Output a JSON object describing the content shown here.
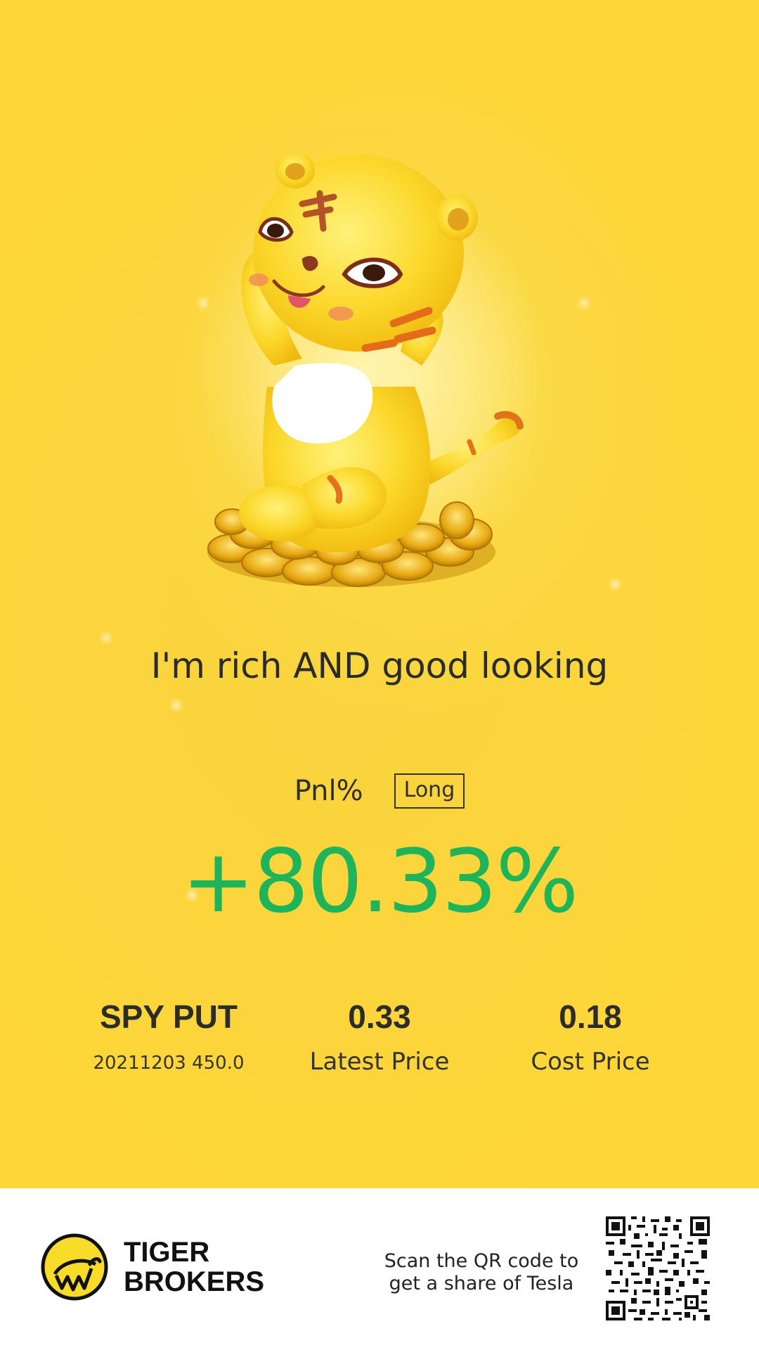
{
  "slogan": "I'm rich AND good looking",
  "pnl": {
    "label": "Pnl%",
    "position_type": "Long",
    "value": "+80.33%",
    "value_color": "#1db45b"
  },
  "stats": [
    {
      "main": "SPY PUT",
      "sub": "20211203 450.0"
    },
    {
      "main": "0.33",
      "sub": "Latest Price"
    },
    {
      "main": "0.18",
      "sub": "Cost Price"
    }
  ],
  "footer": {
    "brand_line1": "TIGER",
    "brand_line2": "BROKERS",
    "scan_line1": "Scan the QR code to",
    "scan_line2": "get a share of Tesla",
    "logo_icon": "tiger-brokers-logo-icon",
    "qr_icon": "qr-code"
  },
  "colors": {
    "background": "#fdd53a",
    "footer": "#ffffff",
    "text": "#2b2b2b"
  }
}
